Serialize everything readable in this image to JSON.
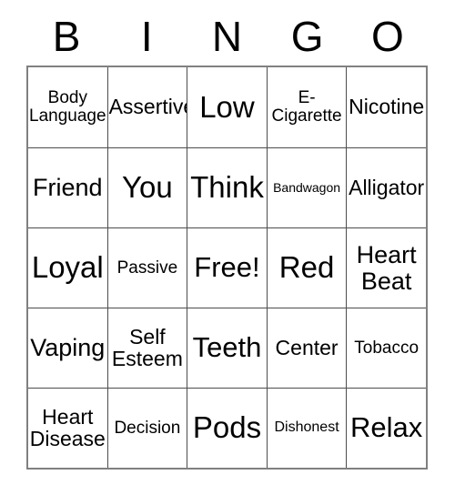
{
  "card": {
    "header_letters": [
      "B",
      "I",
      "N",
      "G",
      "O"
    ],
    "rows": [
      [
        {
          "text": "Body\nLanguage",
          "size": "sm"
        },
        {
          "text": "Assertive",
          "size": "md"
        },
        {
          "text": "Low",
          "size": "xxl"
        },
        {
          "text": "E-\nCigarette",
          "size": "sm"
        },
        {
          "text": "Nicotine",
          "size": "md"
        }
      ],
      [
        {
          "text": "Friend",
          "size": "lg"
        },
        {
          "text": "You",
          "size": "xxl"
        },
        {
          "text": "Think",
          "size": "xxl"
        },
        {
          "text": "Bandwagon",
          "size": "xxs"
        },
        {
          "text": "Alligator",
          "size": "md"
        }
      ],
      [
        {
          "text": "Loyal",
          "size": "xxl"
        },
        {
          "text": "Passive",
          "size": "sm"
        },
        {
          "text": "Free!",
          "size": "xl"
        },
        {
          "text": "Red",
          "size": "xxl"
        },
        {
          "text": "Heart\nBeat",
          "size": "lg"
        }
      ],
      [
        {
          "text": "Vaping",
          "size": "lg"
        },
        {
          "text": "Self\nEsteem",
          "size": "md"
        },
        {
          "text": "Teeth",
          "size": "xl"
        },
        {
          "text": "Center",
          "size": "md"
        },
        {
          "text": "Tobacco",
          "size": "sm"
        }
      ],
      [
        {
          "text": "Heart\nDisease",
          "size": "md"
        },
        {
          "text": "Decision",
          "size": "sm"
        },
        {
          "text": "Pods",
          "size": "xxl"
        },
        {
          "text": "Dishonest",
          "size": "xs"
        },
        {
          "text": "Relax",
          "size": "xl"
        }
      ]
    ],
    "colors": {
      "text": "#000000",
      "background": "#ffffff",
      "outer_border": "#808080",
      "inner_border": "#4d4d4d"
    }
  }
}
